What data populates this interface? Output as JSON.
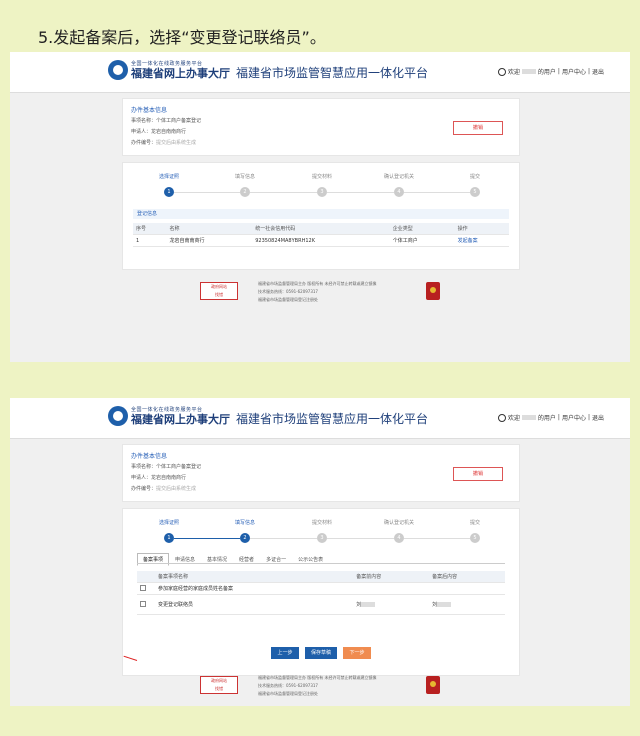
{
  "instruction": "5.发起备案后，选择“变更登记联络员”。",
  "header": {
    "logo_small": "全国一体化在线政务服务平台",
    "logo_big": "福建省网上办事大厅",
    "platform_title": "福建省市场监管智慧应用一体化平台",
    "user_prefix": "欢迎",
    "user_suffix": "的用户",
    "user_center": "用户中心",
    "logout": "退出"
  },
  "info": {
    "title": "办件基本信息",
    "item_label": "事项名称：",
    "item_value": "个体工商户备案登记",
    "applicant_label": "申请人：",
    "applicant_value": "龙岩自南南商行",
    "number_label": "办件编号：",
    "number_value": "提交后由系统生成",
    "withdraw": "撤销"
  },
  "steps": [
    {
      "label": "选择证照",
      "num": "1"
    },
    {
      "label": "填写信息",
      "num": "2"
    },
    {
      "label": "提交材料",
      "num": "3"
    },
    {
      "label": "确认登记机关",
      "num": "4"
    },
    {
      "label": "提交",
      "num": "5"
    }
  ],
  "shot1": {
    "sub_head": "登记信息",
    "columns": [
      "序号",
      "名称",
      "统一社会信用代码",
      "企业类型",
      "操作"
    ],
    "row": [
      "1",
      "龙岩自南南商行",
      "92350824MA8YBRH12K",
      "个体工商户",
      "发起备案"
    ]
  },
  "shot2": {
    "tabs": [
      "备案事项",
      "申请信息",
      "基本情况",
      "经营者",
      "多证合一",
      "公示公告表"
    ],
    "columns": [
      "备案事项名称",
      "备案前内容",
      "备案后内容"
    ],
    "rows": [
      {
        "name": "参加家庭经营的家庭成员姓名备案",
        "before": "",
        "after": ""
      },
      {
        "name": "变更登记联络员",
        "before": "刘",
        "after": "刘"
      }
    ],
    "buttons": {
      "prev": "上一步",
      "save": "保存草稿",
      "next": "下一步"
    }
  },
  "footer": {
    "badge_line1": "政府网站",
    "badge_line2": "找错",
    "line1": "福建省市场监督管理局主办 版权所有 未经许可禁止转载或建立镜像",
    "line2": "技术服务热线：0591-62097317",
    "line3": "福建省市场监督管理局登记注册处"
  },
  "colors": {
    "primary": "#1e5faa",
    "accent": "#f08c50",
    "danger": "#d33333"
  }
}
